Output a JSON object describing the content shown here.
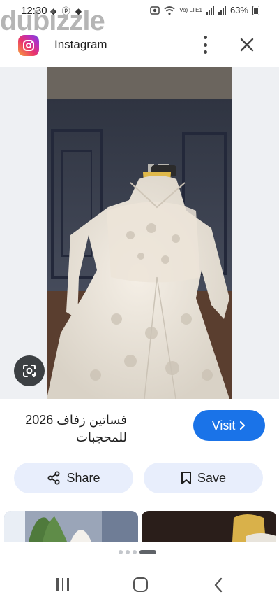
{
  "status_bar": {
    "time": "12:30",
    "left_icons": "◆ ⓟ ◆",
    "volte": "Vo) LTE1",
    "battery": "63%"
  },
  "watermark": "dubizzle",
  "header": {
    "source_name": "Instagram",
    "icons": [
      "instagram-logo",
      "more-vert-icon",
      "close-icon"
    ]
  },
  "image": {
    "icons": [
      "google-lens-icon"
    ]
  },
  "result": {
    "caption": "فساتين زفاف 2026 للمحجبات",
    "visit_label": "Visit",
    "share_label": "Share",
    "save_label": "Save"
  },
  "colors": {
    "accent": "#1a73e8",
    "pill_bg": "#e8eefc",
    "image_bg": "#eef0f3"
  },
  "pager": {
    "current": 4,
    "total": 4
  }
}
